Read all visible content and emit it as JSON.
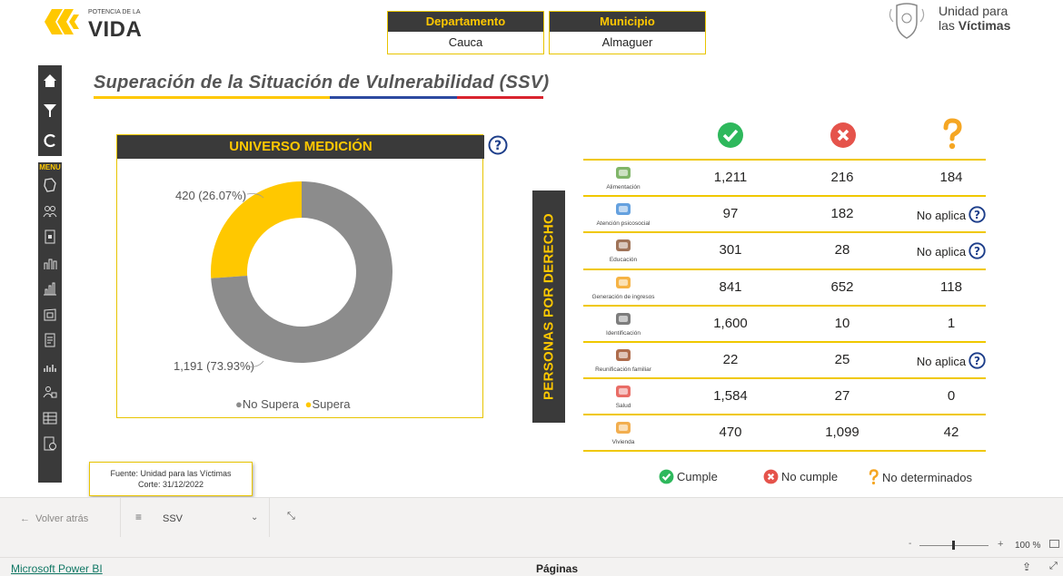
{
  "header": {
    "logo_left_small": "POTENCIA DE LA",
    "logo_left_big": "VIDA",
    "departamento_label": "Departamento",
    "departamento_value": "Cauca",
    "municipio_label": "Municipio",
    "municipio_value": "Almaguer",
    "logo_right_line1": "Unidad para",
    "logo_right_line2_prefix": "las ",
    "logo_right_line2_bold": "Víctimas"
  },
  "nav": {
    "menu_label": "MENU",
    "top_icons": [
      "home-icon",
      "filter-icon",
      "refresh-icon"
    ],
    "menu_icons": [
      "map-icon",
      "people-icon",
      "document-icon",
      "population-icon",
      "bar-chart-icon",
      "territory-map-icon",
      "report-icon",
      "demographics-icon",
      "group-icon",
      "table-icon",
      "export-icon"
    ]
  },
  "page": {
    "title": "Superación de la Situación de Vulnerabilidad (SSV)"
  },
  "universe": {
    "title": "UNIVERSO MEDICIÓN",
    "legend_no_supera": "No Supera",
    "legend_supera": "Supera",
    "label_supera": "420 (26.07%)",
    "label_no_supera": "1,191 (73.93%)"
  },
  "chart_data": {
    "type": "pie",
    "title": "UNIVERSO MEDICIÓN",
    "series": [
      {
        "name": "No Supera",
        "value": 1191,
        "percent": 73.93,
        "color": "#8c8c8c"
      },
      {
        "name": "Supera",
        "value": 420,
        "percent": 26.07,
        "color": "#ffc800"
      }
    ],
    "legend": "bottom",
    "donut": true
  },
  "table": {
    "vertical_label": "PERSONAS POR DERECHO",
    "header_icons": [
      "check-circle-icon",
      "x-circle-icon",
      "question-mark-icon"
    ],
    "rows": [
      {
        "label": "Alimentación",
        "icon": "food-icon",
        "cumple": "1,211",
        "no_cumple": "216",
        "no_det": "184",
        "no_aplica": false
      },
      {
        "label": "Atención psicosocial",
        "icon": "psychosocial-icon",
        "cumple": "97",
        "no_cumple": "182",
        "no_det": "No aplica",
        "no_aplica": true
      },
      {
        "label": "Educación",
        "icon": "education-icon",
        "cumple": "301",
        "no_cumple": "28",
        "no_det": "No aplica",
        "no_aplica": true
      },
      {
        "label": "Generación de ingresos",
        "icon": "income-icon",
        "cumple": "841",
        "no_cumple": "652",
        "no_det": "118",
        "no_aplica": false
      },
      {
        "label": "Identificación",
        "icon": "id-card-icon",
        "cumple": "1,600",
        "no_cumple": "10",
        "no_det": "1",
        "no_aplica": false
      },
      {
        "label": "Reunificación familiar",
        "icon": "family-icon",
        "cumple": "22",
        "no_cumple": "25",
        "no_det": "No aplica",
        "no_aplica": true
      },
      {
        "label": "Salud",
        "icon": "health-icon",
        "cumple": "1,584",
        "no_cumple": "27",
        "no_det": "0",
        "no_aplica": false
      },
      {
        "label": "Vivienda",
        "icon": "house-icon",
        "cumple": "470",
        "no_cumple": "1,099",
        "no_det": "42",
        "no_aplica": false
      }
    ],
    "legend_cumple": "Cumple",
    "legend_no_cumple": "No cumple",
    "legend_no_det": "No determinados"
  },
  "source": {
    "line1": "Fuente: Unidad para las Víctimas",
    "line2": "Corte: 31/12/2022"
  },
  "bottom": {
    "back_label": "Volver atrás",
    "page_name": "SSV",
    "zoom_pct": "100 %",
    "zoom_level": 0.5,
    "app_link": "Microsoft Power BI",
    "pages_label": "Páginas"
  },
  "colors": {
    "accent": "#ffc800",
    "dark": "#3a3a3a",
    "green": "#2eb85c",
    "red": "#e5534b"
  }
}
